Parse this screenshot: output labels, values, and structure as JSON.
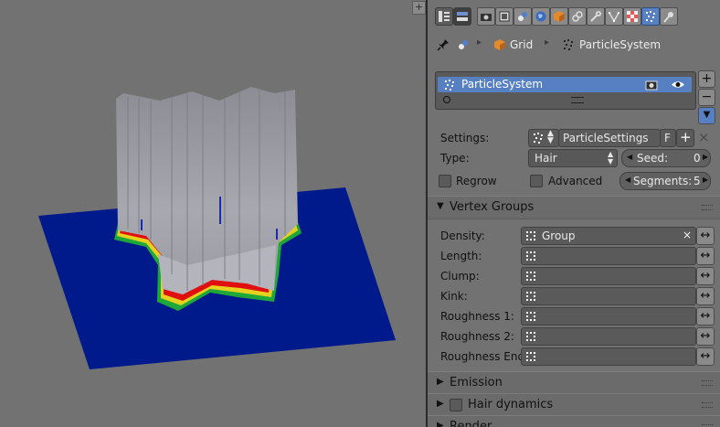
{
  "viewport": {
    "corner_label": "+"
  },
  "toolbar": {
    "tabs": [
      {
        "name": "render-icon"
      },
      {
        "name": "render-layers-icon"
      },
      {
        "name": "scene-icon"
      },
      {
        "name": "world-icon"
      },
      {
        "name": "object-icon"
      },
      {
        "name": "constraints-icon"
      },
      {
        "name": "modifiers-icon"
      },
      {
        "name": "data-icon"
      },
      {
        "name": "material-icon"
      },
      {
        "name": "particles-icon"
      },
      {
        "name": "physics-icon"
      }
    ],
    "active_tab": "particles-icon"
  },
  "breadcrumb": {
    "object": "Grid",
    "system": "ParticleSystem"
  },
  "particle_list": {
    "items": [
      "ParticleSystem"
    ],
    "add_label": "+",
    "remove_label": "−",
    "menu_label": "▼"
  },
  "settings": {
    "settings_label": "Settings:",
    "settings_value": "ParticleSettings",
    "fake_user": "F",
    "new_label": "+",
    "unlink_label": "×",
    "type_label": "Type:",
    "type_value": "Hair",
    "seed_label": "Seed:",
    "seed_value": "0",
    "regrow_label": "Regrow",
    "advanced_label": "Advanced",
    "segments_label": "Segments:",
    "segments_value": "5"
  },
  "vertex_groups": {
    "title": "Vertex Groups",
    "rows": [
      {
        "label": "Density:",
        "value": "Group"
      },
      {
        "label": "Length:",
        "value": ""
      },
      {
        "label": "Clump:",
        "value": ""
      },
      {
        "label": "Kink:",
        "value": ""
      },
      {
        "label": "Roughness 1:",
        "value": ""
      },
      {
        "label": "Roughness 2:",
        "value": ""
      },
      {
        "label": "Roughness End:",
        "value": ""
      }
    ],
    "clear_label": "×",
    "swap_label": "↔"
  },
  "panels": {
    "emission": "Emission",
    "hair_dynamics": "Hair dynamics",
    "render": "Render"
  },
  "colors": {
    "accent": "#5680c2",
    "plane": "#001a8c",
    "hair": "#a6a6ad",
    "heat_red": "#e01010",
    "heat_yellow": "#e6d21e",
    "heat_green": "#1fa83a"
  }
}
